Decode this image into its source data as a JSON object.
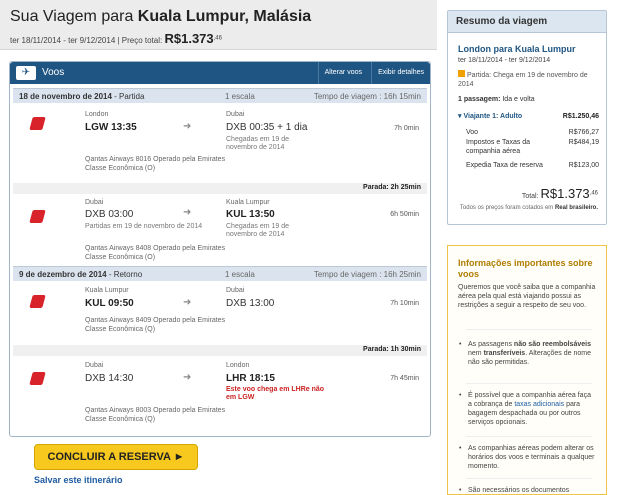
{
  "header": {
    "title_prefix": "Sua Viagem para ",
    "title_dest": "Kuala Lumpur, Malásia",
    "dates": "ter 18/11/2014 - ter 9/12/2014 | Preço total: ",
    "price": "R$1.373",
    "price_cents": ",46"
  },
  "flights": {
    "title": "Voos",
    "alter": "Alterar voos",
    "details": "Exibir detalhes",
    "outbound": {
      "date": "18 de novembro de 2014",
      "sep": " - ",
      "label": "Partida",
      "stops": "1 escala",
      "travel": "Tempo de viagem : 16h 15min"
    },
    "return": {
      "date": "9 de dezembro de 2014",
      "sep": " - ",
      "label": "Retorno",
      "stops": "1 escala",
      "travel": "Tempo de viagem : 16h 25min"
    },
    "legs": [
      {
        "from_city": "London",
        "from_code": "LGW 13:35",
        "to_city": "Dubai",
        "to_code": "DXB 00:35 + 1 dia",
        "arrival_note": "Chegadas em 19 de novembro de 2014",
        "dur": "7h 0min",
        "oper": "Qantas Airways 8016 Operado pela Emirates",
        "cls": "Classe Econômica (O)"
      },
      {
        "from_city": "Dubai",
        "from_code": "DXB 03:00",
        "dep_note": "Partidas em 19 de novembro de 2014",
        "to_city": "Kuala Lumpur",
        "to_code": "KUL 13:50",
        "arrival_note": "Chegadas em 19 de novembro de 2014",
        "dur": "6h 50min",
        "oper": "Qantas Airways 8408 Operado pela Emirates",
        "cls": "Classe Econômica (O)"
      },
      {
        "from_city": "Kuala Lumpur",
        "from_code": "KUL 09:50",
        "to_city": "Dubai",
        "to_code": "DXB 13:00",
        "dur": "7h 10min",
        "oper": "Qantas Airways 8409 Operado pela Emirates",
        "cls": "Classe Econômica (Q)"
      },
      {
        "from_city": "Dubai",
        "from_code": "DXB 14:30",
        "to_city": "London",
        "to_code": "LHR 18:15",
        "warn": "Este voo chega em LHRe não em LGW",
        "dur": "7h 45min",
        "oper": "Qantas Airways 8003 Operado pela Emirates",
        "cls": "Classe Econômica (Q)"
      }
    ],
    "stop1": "Parada:  2h 25min",
    "stop2": "Parada:  1h 30min"
  },
  "cta": "CONCLUIR A RESERVA  ►",
  "save": "Salvar este itinerário",
  "summary": {
    "title": "Resumo da viagem",
    "route": "London para Kuala Lumpur",
    "dates": "ter 18/11/2014 - ter 9/12/2014",
    "warn": "Partida: Chega em 19 de novembro de 2014",
    "pax": "1 passagem:",
    "pax_type": " Ida e volta",
    "adult": "▾ Viajante 1: Adulto",
    "adult_total": "R$1.250,46",
    "items": [
      {
        "k": "Voo",
        "v": "R$766,27"
      },
      {
        "k": "Impostos e Taxas da companhia aérea",
        "v": "R$484,19"
      },
      {
        "k": "Expedia Taxa de reserva",
        "v": "R$123,00"
      }
    ],
    "total_label": "Total: ",
    "total": "R$1.373",
    "total_cents": ",46",
    "foot1": "Todos os preços foram cotados em ",
    "foot2": "Real brasileiro."
  },
  "info": {
    "title": "Informações importantes sobre voos",
    "intro": "Queremos que você saiba que a companhia aérea pela qual está viajando possui as restrições a seguir a respeito de seu voo.",
    "b1a": "As passagens ",
    "b1b": "não são reembolsáveis",
    "b1c": " nem ",
    "b1d": "transferíveis",
    "b1e": ". Alterações de nome não são permitidas.",
    "b2a": "É possível que a companhia aérea faça a cobrança de ",
    "b2b": "taxas adicionais",
    "b2c": " para bagagem despachada ou por outros serviços opcionais.",
    "b3": "As companhias aéreas podem alterar os horários dos voos e terminais a qualquer momento.",
    "b4": "São necessários os documentos"
  }
}
